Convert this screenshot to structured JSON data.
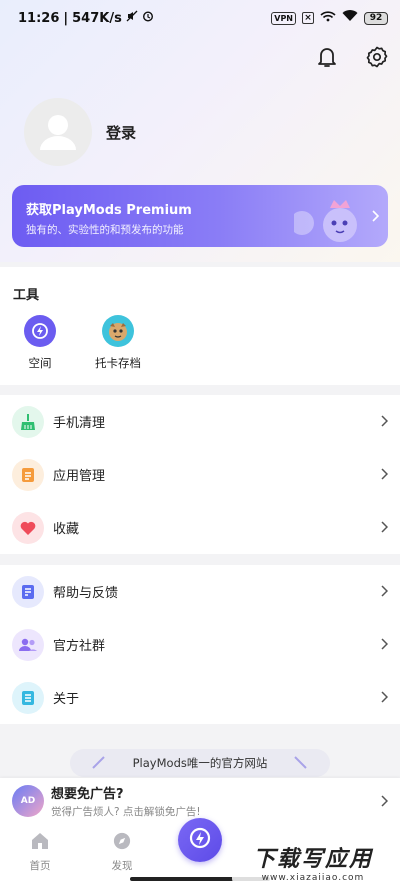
{
  "status_bar": {
    "time": "11:26",
    "network_speed": "547K/s",
    "vpn": "VPN",
    "battery": "92"
  },
  "header": {
    "icons": [
      "bell-icon",
      "settings-gear-icon"
    ]
  },
  "profile": {
    "login_label": "登录"
  },
  "premium": {
    "title": "获取PlayMods Premium",
    "subtitle": "独有的、实验性的和预发布的功能"
  },
  "tools": {
    "title": "工具",
    "items": [
      {
        "label": "空间",
        "icon": "space-icon"
      },
      {
        "label": "托卡存档",
        "icon": "toca-save-icon"
      }
    ]
  },
  "menu_group_1": [
    {
      "label": "手机清理",
      "icon": "broom-clean-icon",
      "color": "#2fbf71"
    },
    {
      "label": "应用管理",
      "icon": "app-manage-icon",
      "color": "#f59b3c"
    },
    {
      "label": "收藏",
      "icon": "heart-icon",
      "color": "#ef4b5a"
    }
  ],
  "menu_group_2": [
    {
      "label": "帮助与反馈",
      "icon": "help-feedback-icon",
      "color": "#5b6cf0"
    },
    {
      "label": "官方社群",
      "icon": "community-icon",
      "color": "#8b6cf0"
    },
    {
      "label": "关于",
      "icon": "about-icon",
      "color": "#35b8e0"
    }
  ],
  "site_pill": {
    "text": "PlayMods唯一的官方网站"
  },
  "ad_banner": {
    "title": "想要免广告?",
    "subtitle": "觉得广告烦人? 点击解锁免广告!",
    "icon_text": "AD"
  },
  "bottom_nav": {
    "items": [
      {
        "label": "首页",
        "icon": "home-icon"
      },
      {
        "label": "发现",
        "icon": "compass-icon"
      }
    ]
  },
  "watermark": {
    "main": "下载写应用",
    "sub": "www.xiazaiiao.com"
  },
  "colors": {
    "accent": "#6d5cf2"
  }
}
